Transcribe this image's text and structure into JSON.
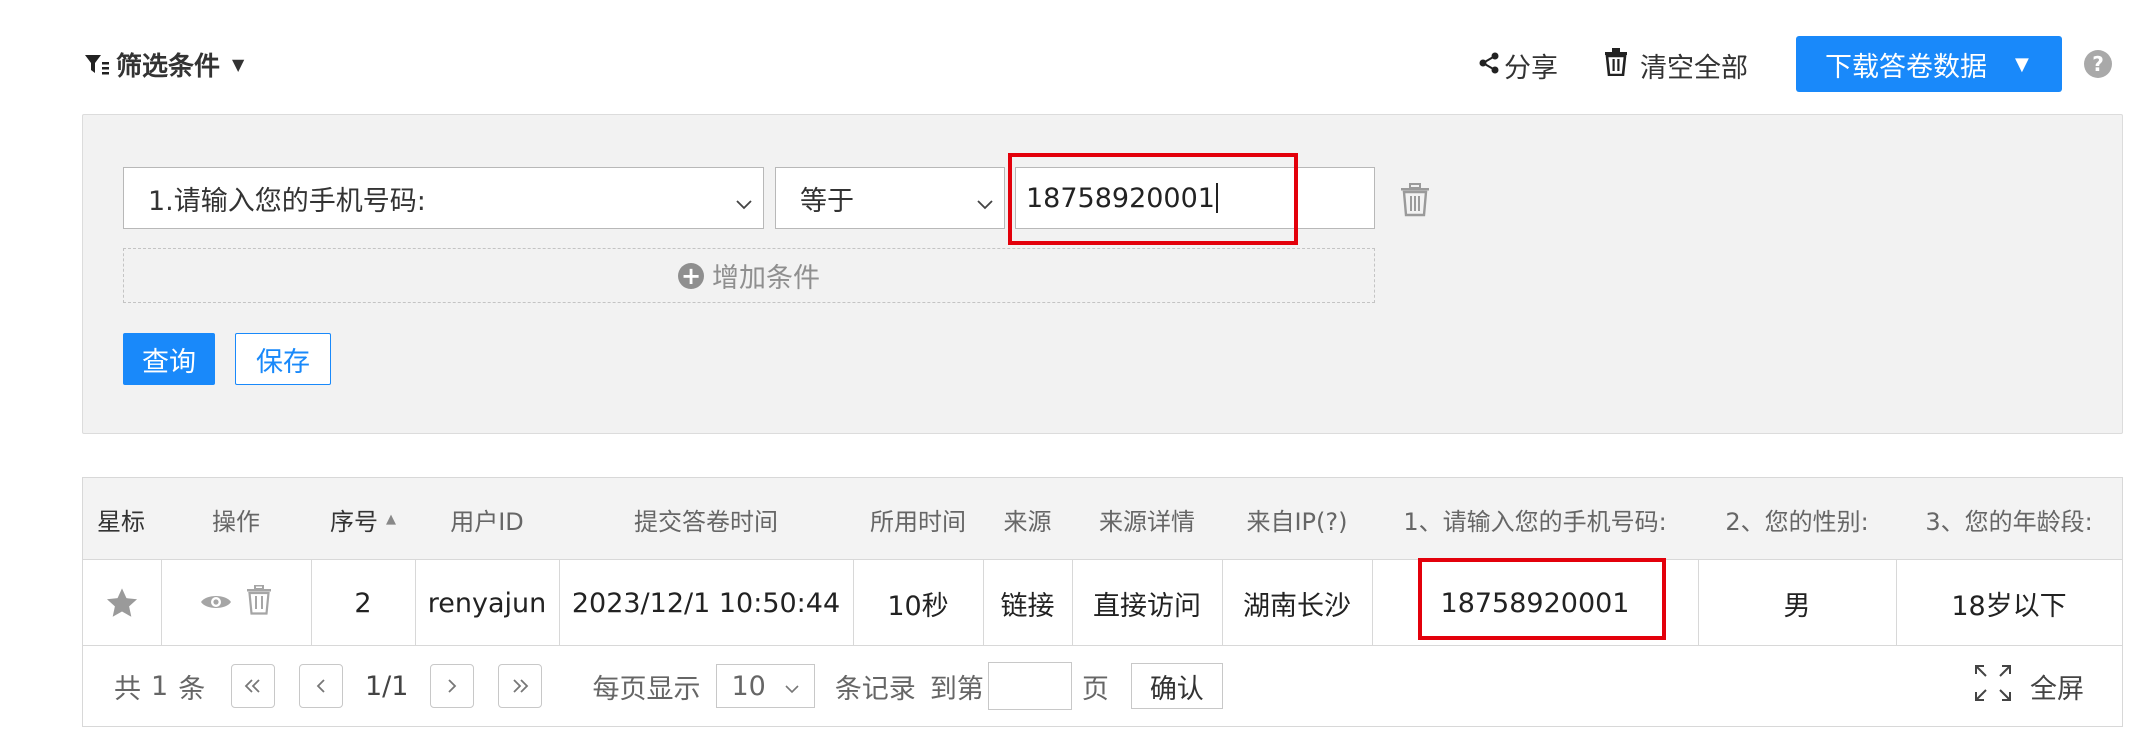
{
  "toolbar": {
    "filter_label": "筛选条件",
    "share_label": "分享",
    "clear_all_label": "清空全部",
    "download_label": "下载答卷数据",
    "help_label": "?"
  },
  "filter": {
    "question_select": "1.请输入您的手机号码:",
    "operator_select": "等于",
    "value_input": "18758920001",
    "add_condition": "增加条件",
    "query_button": "查询",
    "save_button": "保存"
  },
  "table": {
    "headers": [
      "星标",
      "操作",
      "序号",
      "用户ID",
      "提交答卷时间",
      "所用时间",
      "来源",
      "来源详情",
      "来自IP(?)",
      "1、请输入您的手机号码:",
      "2、您的性别:",
      "3、您的年龄段:"
    ],
    "sorted_column": "序号",
    "rows": [
      {
        "seq": "2",
        "user_id": "renyajun",
        "submit_time": "2023/12/1 10:50:44",
        "duration": "10秒",
        "source": "链接",
        "source_detail": "直接访问",
        "ip_location": "湖南长沙",
        "phone": "18758920001",
        "gender": "男",
        "age_group": "18岁以下"
      }
    ]
  },
  "pagination": {
    "total_prefix": "共",
    "total_count": "1",
    "total_suffix": "条",
    "page_info": "1/1",
    "per_page_label": "每页显示",
    "per_page_value": "10",
    "records_label": "条记录",
    "goto_label": "到第",
    "page_label": "页",
    "confirm_label": "确认",
    "fullscreen_label": "全屏"
  },
  "colors": {
    "primary": "#1989fa",
    "highlight": "#e3000b",
    "panel_bg": "#f2f2f2"
  }
}
